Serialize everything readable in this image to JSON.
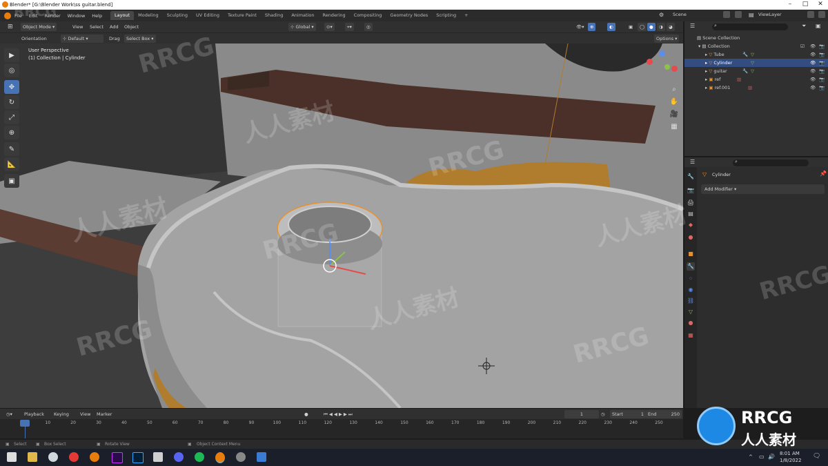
{
  "window": {
    "title": "Blender* [G:\\Blender Work\\ss guitar.blend]"
  },
  "menu": [
    "File",
    "Edit",
    "Render",
    "Window",
    "Help"
  ],
  "workspaces": [
    "Layout",
    "Modeling",
    "Sculpting",
    "UV Editing",
    "Texture Paint",
    "Shading",
    "Animation",
    "Rendering",
    "Compositing",
    "Geometry Nodes",
    "Scripting"
  ],
  "scene": {
    "label": "Scene",
    "view_layer": "ViewLayer"
  },
  "viewport_header": {
    "mode": "Object Mode",
    "view": "View",
    "select": "Select",
    "add": "Add",
    "object": "Object",
    "transform": "Global",
    "options": "Options"
  },
  "tool_settings": {
    "orientation_label": "Orientation",
    "orientation_value": "Default",
    "drag_label": "Drag",
    "drag_value": "Select Box"
  },
  "viewport": {
    "perspective": "User Perspective",
    "context": "(1) Collection | Cylinder"
  },
  "outliner": {
    "root": "Scene Collection",
    "items": [
      {
        "name": "Collection",
        "indent": 1
      },
      {
        "name": "Tube",
        "indent": 2
      },
      {
        "name": "Cylinder",
        "indent": 2,
        "selected": true
      },
      {
        "name": "guitar",
        "indent": 2
      },
      {
        "name": "ref",
        "indent": 2
      },
      {
        "name": "ref.001",
        "indent": 2
      }
    ]
  },
  "properties": {
    "object_name": "Cylinder",
    "add_modifier": "Add Modifier"
  },
  "timeline": {
    "menu": [
      "Playback",
      "Keying",
      "View",
      "Marker"
    ],
    "current_frame": "1",
    "start_label": "Start",
    "start": "1",
    "end_label": "End",
    "end": "250",
    "ticks": [
      "1",
      "10",
      "20",
      "30",
      "40",
      "50",
      "60",
      "70",
      "80",
      "90",
      "100",
      "110",
      "120",
      "130",
      "140",
      "150",
      "160",
      "170",
      "180",
      "190",
      "200",
      "210",
      "220",
      "230",
      "240",
      "250"
    ]
  },
  "status_bar": {
    "select": "Select",
    "box_select": "Box Select",
    "rotate_view": "Rotate View",
    "context_menu": "Object Context Menu"
  },
  "taskbar": {
    "time": "8:01 AM",
    "date": "1/8/2022"
  },
  "watermarks": {
    "brand": "RRCG",
    "chinese": "人人素材"
  },
  "colors": {
    "accent": "#4772b3",
    "selection_outline": "#e8902c",
    "outliner_selected": "#334d80"
  }
}
